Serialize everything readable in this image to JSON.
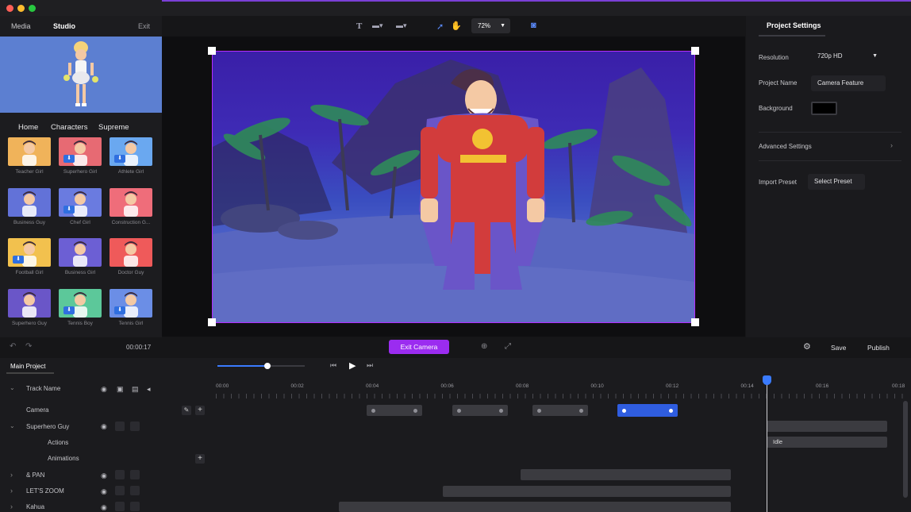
{
  "left_panel": {
    "top_tabs": [
      "Media",
      "Studio",
      "Exit"
    ],
    "sub_tabs": [
      "Home",
      "Characters",
      "Supreme"
    ],
    "characters": [
      {
        "label": "Teacher Girl",
        "bg": "#f0b35a",
        "dl": false
      },
      {
        "label": "Superhero Girl",
        "bg": "#e76a73",
        "dl": true
      },
      {
        "label": "Athlete Girl",
        "bg": "#6aa8f0",
        "dl": true
      },
      {
        "label": "Business Guy",
        "bg": "#6272d8",
        "dl": false
      },
      {
        "label": "Chef Girl",
        "bg": "#6a7be0",
        "dl": true
      },
      {
        "label": "Construction G...",
        "bg": "#ef6d7a",
        "dl": false
      },
      {
        "label": "Football Girl",
        "bg": "#f2c14e",
        "dl": true
      },
      {
        "label": "Business Girl",
        "bg": "#6c5fd4",
        "dl": false
      },
      {
        "label": "Doctor Guy",
        "bg": "#ef5a5a",
        "dl": false
      },
      {
        "label": "Superhero Guy",
        "bg": "#6a56c8",
        "dl": false
      },
      {
        "label": "Tennis Boy",
        "bg": "#5cc89a",
        "dl": true
      },
      {
        "label": "Tennis Girl",
        "bg": "#6b8ee6",
        "dl": true
      }
    ]
  },
  "toolbar": {
    "zoom": "72%"
  },
  "right_panel": {
    "title": "Project Settings",
    "resolution_label": "Resolution",
    "resolution_value": "720p HD",
    "project_name_label": "Project Name",
    "project_name_value": "Camera Feature",
    "background_label": "Background",
    "background_color": "#000000",
    "advanced_label": "Advanced Settings",
    "import_label": "Import Preset",
    "select_preset": "Select Preset"
  },
  "controls": {
    "time": "00:00:17",
    "exit_camera": "Exit Camera",
    "save": "Save",
    "publish": "Publish"
  },
  "timeline": {
    "project_tab": "Main Project",
    "ticks": [
      "00:00",
      "00:02",
      "00:04",
      "00:06",
      "00:08",
      "00:10",
      "00:12",
      "00:14",
      "00:16",
      "00:18"
    ],
    "tracks": {
      "header": "Track Name",
      "camera": "Camera",
      "superhero": "Superhero Guy",
      "actions": "Actions",
      "animations": "Animations",
      "pan": "& PAN",
      "zoom": "LET'S ZOOM",
      "kahua": "Kahua"
    },
    "idle_clip": "Idle"
  },
  "colors": {
    "accent": "#9b2cf0",
    "selection": "#b32cff",
    "playhead": "#3a7bff"
  }
}
